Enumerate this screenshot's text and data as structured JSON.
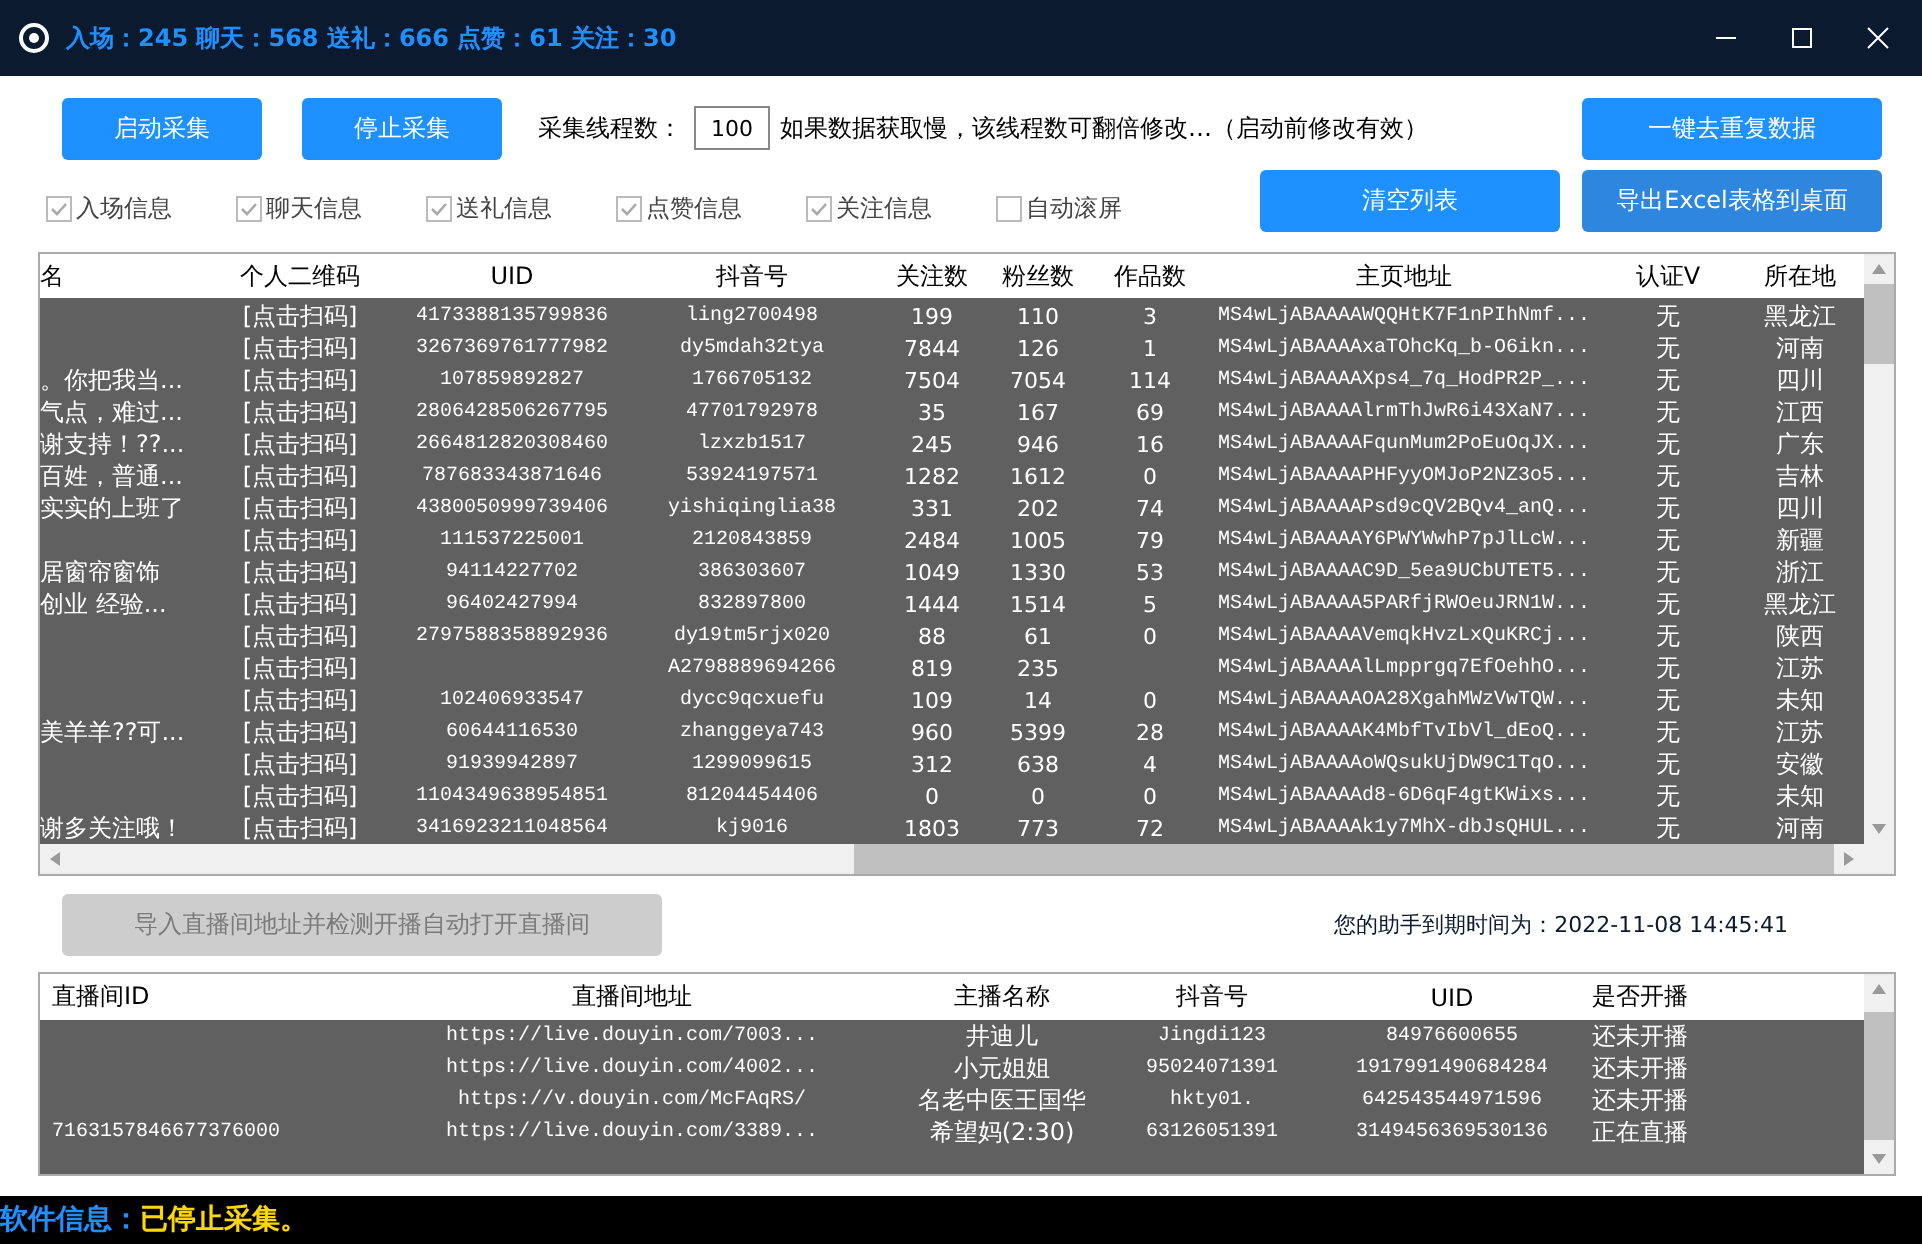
{
  "window": {
    "title": "入场：245 聊天：568 送礼：666 点赞：61 关注：30"
  },
  "toolbar": {
    "start_button": "启动采集",
    "stop_button": "停止采集",
    "threads_label": "采集线程数：",
    "threads_value": "100",
    "threads_hint": "如果数据获取慢，该线程数可翻倍修改…（启动前修改有效）",
    "dedupe_button": "一键去重复数据",
    "clear_button": "清空列表",
    "export_button": "导出Excel表格到桌面"
  },
  "filters": [
    {
      "label": "入场信息",
      "checked": true
    },
    {
      "label": "聊天信息",
      "checked": true
    },
    {
      "label": "送礼信息",
      "checked": true
    },
    {
      "label": "点赞信息",
      "checked": true
    },
    {
      "label": "关注信息",
      "checked": true
    },
    {
      "label": "自动滚屏",
      "checked": false
    }
  ],
  "table": {
    "columns": [
      "名",
      "个人二维码",
      "UID",
      "抖音号",
      "关注数",
      "粉丝数",
      "作品数",
      "主页地址",
      "认证V",
      "所在地"
    ],
    "rows": [
      [
        "",
        "[点击扫码]",
        "4173388135799836",
        "ling2700498",
        "199",
        "110",
        "3",
        "MS4wLjABAAAAWQQHtK7F1nPIhNmf...",
        "无",
        "黑龙江"
      ],
      [
        "",
        "[点击扫码]",
        "3267369761777982",
        "dy5mdah32tya",
        "7844",
        "126",
        "1",
        "MS4wLjABAAAAxaTOhcKq_b-O6ikn...",
        "无",
        "河南"
      ],
      [
        "。你把我当...",
        "[点击扫码]",
        "107859892827",
        "1766705132",
        "7504",
        "7054",
        "114",
        "MS4wLjABAAAAXps4_7q_HodPR2P_...",
        "无",
        "四川"
      ],
      [
        "气点，难过...",
        "[点击扫码]",
        "2806428506267795",
        "47701792978",
        "35",
        "167",
        "69",
        "MS4wLjABAAAAlrmThJwR6i43XaN7...",
        "无",
        "江西"
      ],
      [
        "谢支持！??...",
        "[点击扫码]",
        "2664812820308460",
        "lzxzb1517",
        "245",
        "946",
        "16",
        "MS4wLjABAAAAFqunMum2PoEuOqJX...",
        "无",
        "广东"
      ],
      [
        "百姓，普通...",
        "[点击扫码]",
        "787683343871646",
        "53924197571",
        "1282",
        "1612",
        "0",
        "MS4wLjABAAAAPHFyyOMJoP2NZ3o5...",
        "无",
        "吉林"
      ],
      [
        "实实的上班了",
        "[点击扫码]",
        "4380050999739406",
        "yishiqinglia38",
        "331",
        "202",
        "74",
        "MS4wLjABAAAAPsd9cQV2BQv4_anQ...",
        "无",
        "四川"
      ],
      [
        "",
        "[点击扫码]",
        "111537225001",
        "2120843859",
        "2484",
        "1005",
        "79",
        "MS4wLjABAAAAY6PWYWwhP7pJlLcW...",
        "无",
        "新疆"
      ],
      [
        "居窗帘窗饰",
        "[点击扫码]",
        "94114227702",
        "386303607",
        "1049",
        "1330",
        "53",
        "MS4wLjABAAAAC9D_5ea9UCbUTET5...",
        "无",
        "浙江"
      ],
      [
        "创业 经验...",
        "[点击扫码]",
        "96402427994",
        "832897800",
        "1444",
        "1514",
        "5",
        "MS4wLjABAAAA5PARfjRWOeuJRN1W...",
        "无",
        "黑龙江"
      ],
      [
        "",
        "[点击扫码]",
        "2797588358892936",
        "dy19tm5rjx020",
        "88",
        "61",
        "0",
        "MS4wLjABAAAAVemqkHvzLxQuKRCj...",
        "无",
        "陕西"
      ],
      [
        "",
        "[点击扫码]",
        "",
        "A2798889694266",
        "819",
        "235",
        "",
        "MS4wLjABAAAAlLmpprgq7EfOehhO...",
        "无",
        "江苏"
      ],
      [
        "",
        "[点击扫码]",
        "102406933547",
        "dycc9qcxuefu",
        "109",
        "14",
        "0",
        "MS4wLjABAAAAOA28XgahMWzVwTQW...",
        "无",
        "未知"
      ],
      [
        "美羊羊??可...",
        "[点击扫码]",
        "60644116530",
        "zhanggeya743",
        "960",
        "5399",
        "28",
        "MS4wLjABAAAAK4MbfTvIbVl_dEoQ...",
        "无",
        "江苏"
      ],
      [
        "",
        "[点击扫码]",
        "91939942897",
        "1299099615",
        "312",
        "638",
        "4",
        "MS4wLjABAAAAoWQsukUjDW9C1TqO...",
        "无",
        "安徽"
      ],
      [
        "",
        "[点击扫码]",
        "1104349638954851",
        "81204454406",
        "0",
        "0",
        "0",
        "MS4wLjABAAAAd8-6D6qF4gtKWixs...",
        "无",
        "未知"
      ],
      [
        "谢多关注哦！",
        "[点击扫码]",
        "3416923211048564",
        "kj9016",
        "1803",
        "773",
        "72",
        "MS4wLjABAAAAk1y7MhX-dbJsQHUL...",
        "无",
        "河南"
      ]
    ]
  },
  "import_button": {
    "label": "导入直播间地址并检测开播自动打开直播间",
    "disabled": true
  },
  "expiry": "您的助手到期时间为：2022-11-08 14:45:41",
  "live_table": {
    "columns": [
      "直播间ID",
      "直播间地址",
      "主播名称",
      "抖音号",
      "UID",
      "是否开播"
    ],
    "rows": [
      [
        "",
        "https://live.douyin.com/7003...",
        "井迪儿",
        "Jingdi123",
        "84976600655",
        "还未开播"
      ],
      [
        "",
        "https://live.douyin.com/4002...",
        "小元姐姐",
        "95024071391",
        "1917991490684284",
        "还未开播"
      ],
      [
        "",
        "https://v.douyin.com/McFAqRS/",
        "名老中医王国华",
        "hkty01.",
        "642543544971596",
        "还未开播"
      ],
      [
        "7163157846677376000",
        "https://live.douyin.com/3389...",
        "希望妈(2:30)",
        "63126051391",
        "3149456369530136",
        "正在直播"
      ]
    ]
  },
  "status_bar": {
    "label": "软件信息：",
    "message": "已停止采集。"
  }
}
